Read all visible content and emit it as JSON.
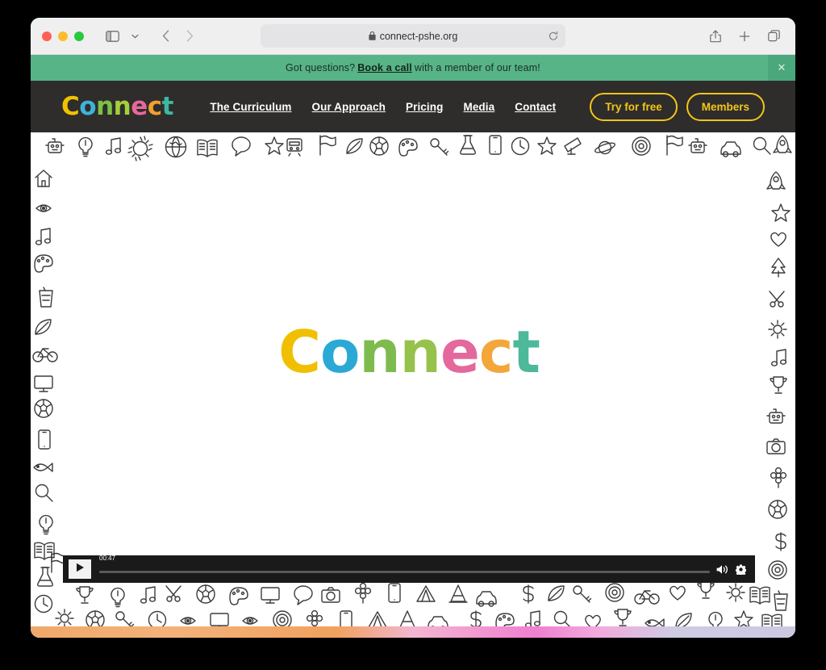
{
  "browser": {
    "url": "connect-pshe.org",
    "lock_icon": "lock-icon",
    "reload_icon": "reload-icon",
    "sidebar_icon": "sidebar-toggle-icon",
    "chevron_icon": "chevron-down-icon",
    "back_icon": "back-arrow-icon",
    "forward_icon": "forward-arrow-icon",
    "share_icon": "share-icon",
    "newtab_icon": "plus-icon",
    "tabs_icon": "tabs-overview-icon",
    "traffic_lights": [
      "close-red",
      "minimize-yellow",
      "maximize-green"
    ]
  },
  "banner": {
    "pre_text": "Got questions? ",
    "link_text": "Book a call",
    "post_text": " with a member of our team!",
    "close_label": "✕",
    "bg_color": "#56b487"
  },
  "header": {
    "logo_text": "Connect",
    "logo_letters": [
      {
        "char": "C",
        "color": "#f2c200"
      },
      {
        "char": "o",
        "color": "#3fb3d8"
      },
      {
        "char": "n",
        "color": "#7dc242"
      },
      {
        "char": "n",
        "color": "#a6ce39"
      },
      {
        "char": "e",
        "color": "#e8689a"
      },
      {
        "char": "c",
        "color": "#f0a030"
      },
      {
        "char": "t",
        "color": "#3eb8a0"
      }
    ],
    "bg_color": "#2e2d2c",
    "nav_items": [
      {
        "label": "The Curriculum"
      },
      {
        "label": "Our Approach"
      },
      {
        "label": "Pricing"
      },
      {
        "label": "Media"
      },
      {
        "label": "Contact"
      }
    ],
    "buttons": [
      {
        "label": "Try for free"
      },
      {
        "label": "Members"
      }
    ],
    "accent_color": "#f5c516"
  },
  "video": {
    "logo_text": "Connect",
    "logo_letters": [
      {
        "char": "C",
        "color": "#f0c000"
      },
      {
        "char": "o",
        "color": "#2aa9d6"
      },
      {
        "char": "n",
        "color": "#7dbb4e"
      },
      {
        "char": "n",
        "color": "#96c24c"
      },
      {
        "char": "e",
        "color": "#e4689c"
      },
      {
        "char": "c",
        "color": "#f3a63a"
      },
      {
        "char": "t",
        "color": "#4db89a"
      }
    ],
    "time_label": "00:47",
    "play_icon": "play-icon",
    "volume_icon": "volume-icon",
    "settings_icon": "gear-icon",
    "progress_percent": 0
  }
}
